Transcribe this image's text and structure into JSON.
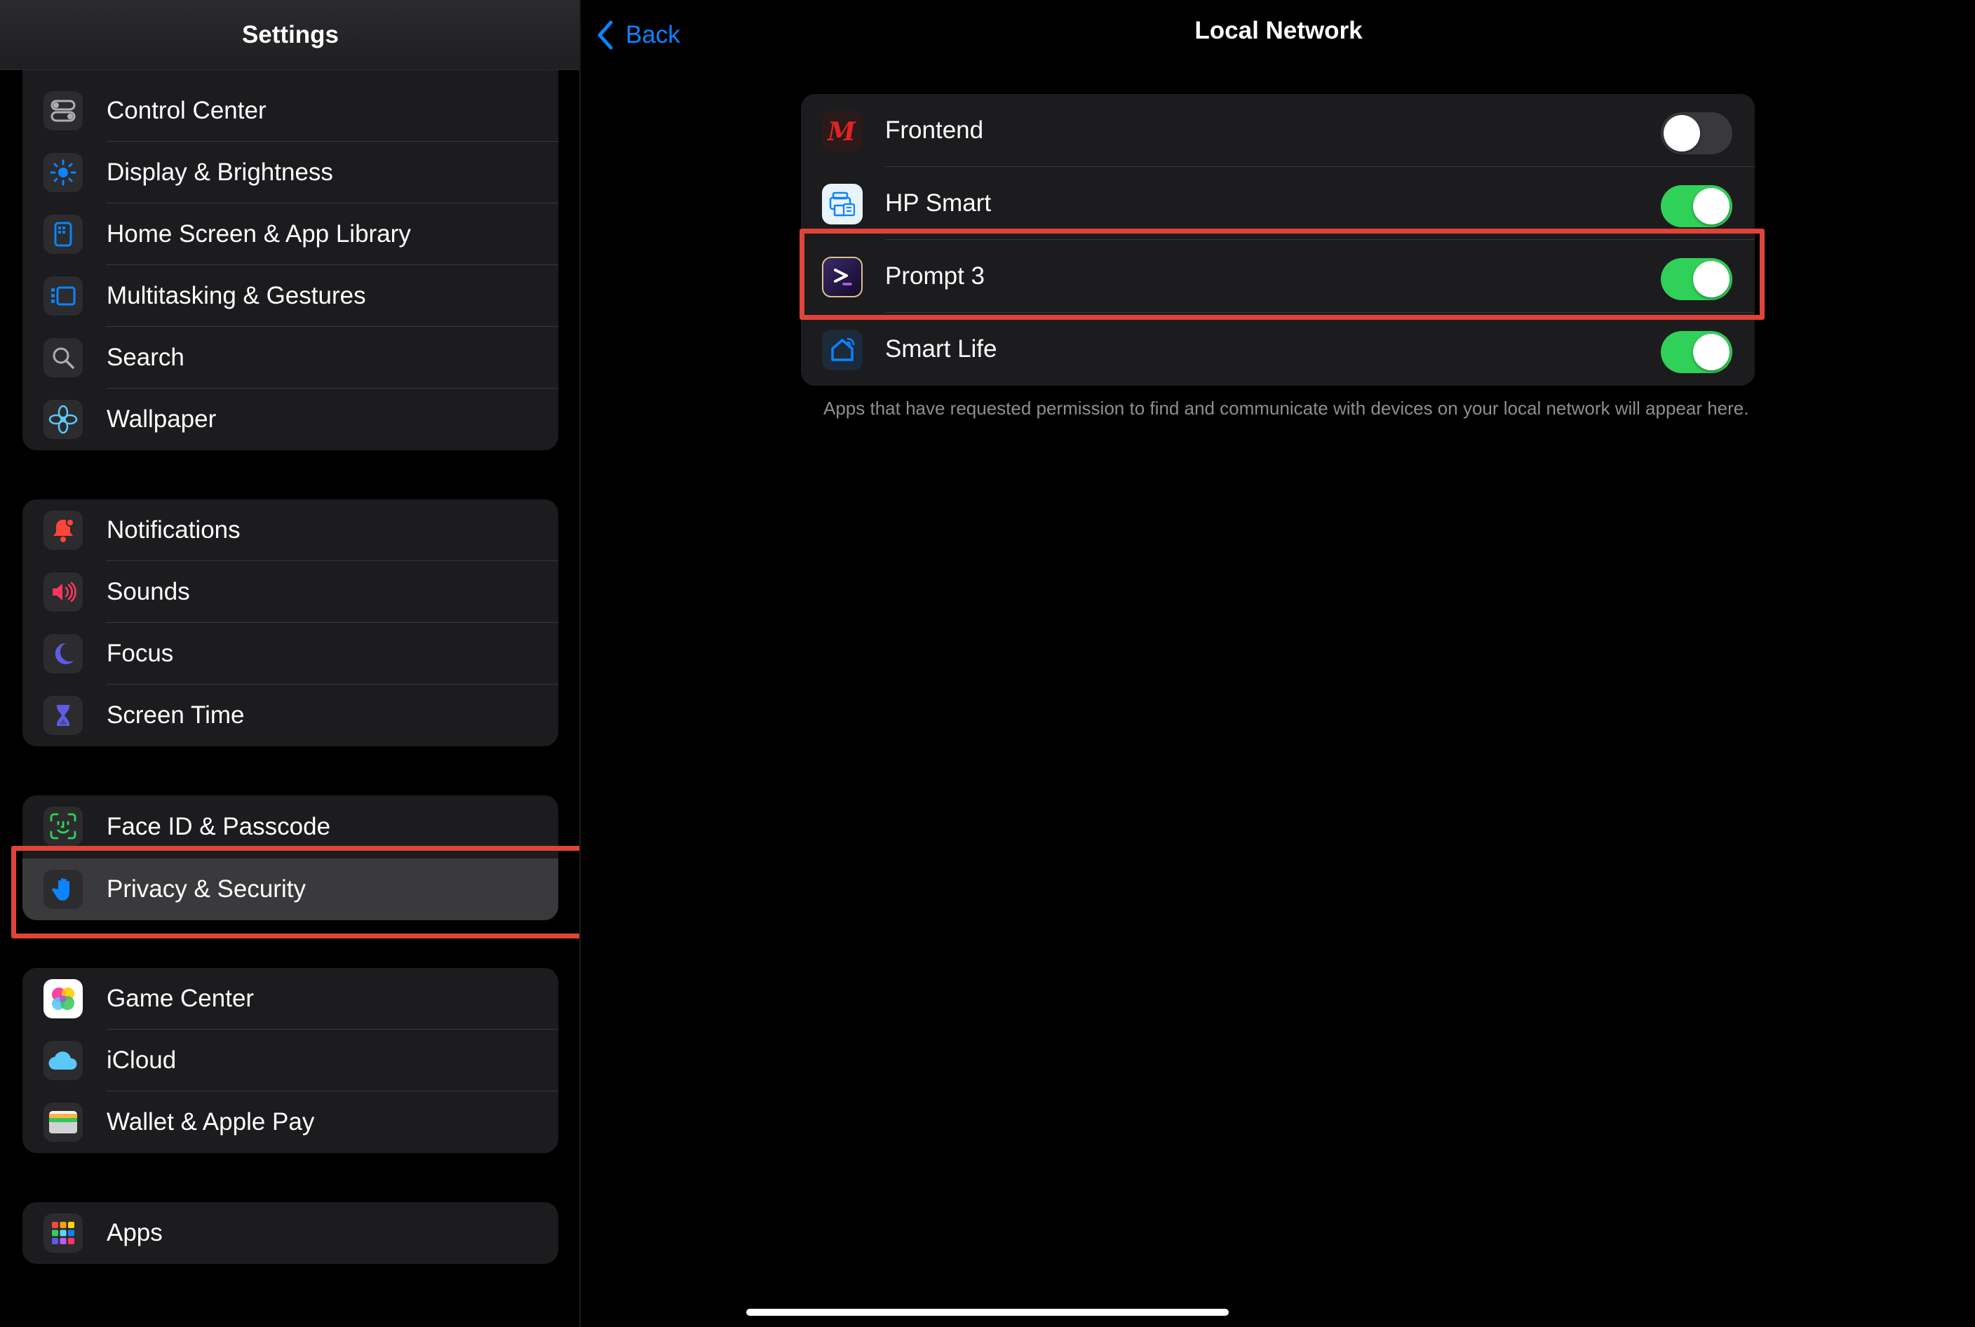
{
  "sidebar": {
    "title": "Settings",
    "groups": [
      {
        "items": [
          {
            "label": "Control Center",
            "icon": "control-center-icon"
          },
          {
            "label": "Display & Brightness",
            "icon": "sun-icon"
          },
          {
            "label": "Home Screen & App Library",
            "icon": "home-screen-icon"
          },
          {
            "label": "Multitasking & Gestures",
            "icon": "multitasking-icon"
          },
          {
            "label": "Search",
            "icon": "search-icon"
          },
          {
            "label": "Wallpaper",
            "icon": "wallpaper-flower-icon"
          }
        ]
      },
      {
        "items": [
          {
            "label": "Notifications",
            "icon": "bell-icon"
          },
          {
            "label": "Sounds",
            "icon": "speaker-icon"
          },
          {
            "label": "Focus",
            "icon": "moon-icon"
          },
          {
            "label": "Screen Time",
            "icon": "hourglass-icon"
          }
        ]
      },
      {
        "items": [
          {
            "label": "Face ID & Passcode",
            "icon": "face-id-icon"
          },
          {
            "label": "Privacy & Security",
            "icon": "hand-icon",
            "selected": true
          }
        ]
      },
      {
        "items": [
          {
            "label": "Game Center",
            "icon": "game-center-icon"
          },
          {
            "label": "iCloud",
            "icon": "cloud-icon"
          },
          {
            "label": "Wallet & Apple Pay",
            "icon": "wallet-icon"
          }
        ]
      },
      {
        "items": [
          {
            "label": "Apps",
            "icon": "apps-grid-icon"
          }
        ]
      }
    ]
  },
  "detail": {
    "back_label": "Back",
    "title": "Local Network",
    "apps": [
      {
        "label": "Frontend",
        "icon": "frontend-app-icon",
        "enabled": false
      },
      {
        "label": "HP Smart",
        "icon": "hp-smart-icon",
        "enabled": true
      },
      {
        "label": "Prompt 3",
        "icon": "prompt-3-icon",
        "enabled": true
      },
      {
        "label": "Smart Life",
        "icon": "smart-life-icon",
        "enabled": true
      }
    ],
    "footnote": "Apps that have requested permission to find and communicate with devices on your local network will appear here."
  },
  "colors": {
    "accent": "#0a84ff",
    "toggle_on": "#30d158",
    "highlight": "#e04438"
  }
}
